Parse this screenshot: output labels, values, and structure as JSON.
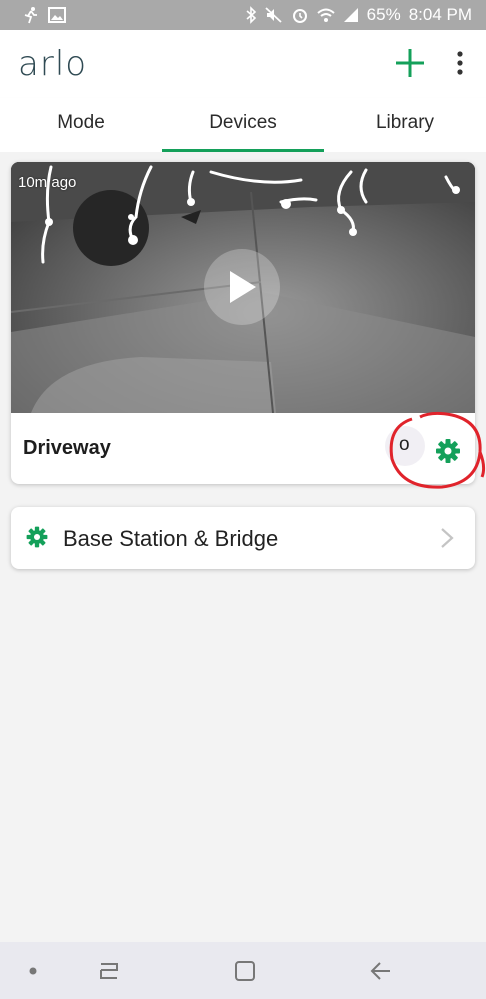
{
  "status_bar": {
    "battery": "65%",
    "time": "8:04 PM",
    "left_icons": [
      "activity-icon",
      "image-icon"
    ],
    "right_icons": [
      "bluetooth-icon",
      "mute-icon",
      "alarm-icon",
      "wifi-icon",
      "signal-icon"
    ]
  },
  "app_bar": {
    "logo": "arlo",
    "add_icon": "plus-icon",
    "more_icon": "more-vert-icon"
  },
  "tabs": [
    {
      "label": "Mode",
      "active": false
    },
    {
      "label": "Devices",
      "active": true
    },
    {
      "label": "Library",
      "active": false
    }
  ],
  "camera": {
    "time_ago": "10m ago",
    "name": "Driveway",
    "partial_icon_text": "o"
  },
  "base_station": {
    "label": "Base Station & Bridge"
  },
  "colors": {
    "accent": "#14a05a",
    "logo": "#2f4a53",
    "annotation": "#e0232b"
  }
}
